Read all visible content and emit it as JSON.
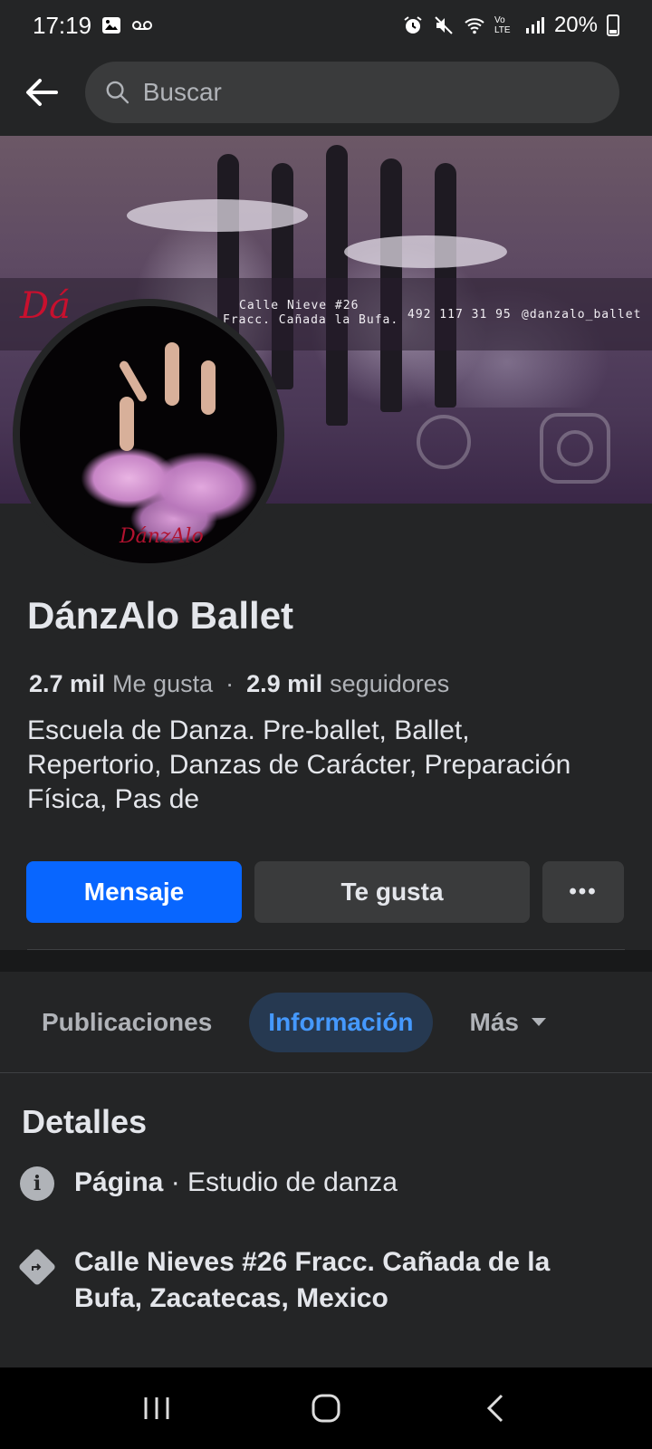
{
  "status_bar": {
    "time": "17:19",
    "network": "Vo LTE",
    "battery": "20%"
  },
  "search": {
    "placeholder": "Buscar"
  },
  "cover": {
    "logo_text": "Dá",
    "address_line1": "Calle Nieve #26",
    "address_line2": "Fracc. Cañada la Bufa.",
    "phone": "492 117 31 95",
    "handle": "@danzalo_ballet"
  },
  "avatar": {
    "signature": "DánzAlo"
  },
  "profile": {
    "name": "DánzAlo Ballet",
    "likes_count": "2.7 mil",
    "likes_label": "Me gusta",
    "separator": "·",
    "followers_count": "2.9 mil",
    "followers_label": "seguidores",
    "bio": "Escuela de Danza. Pre-ballet, Ballet, Repertorio, Danzas de Carácter, Preparación Física, Pas de"
  },
  "actions": {
    "message": "Mensaje",
    "like": "Te gusta",
    "more": "•••"
  },
  "tabs": [
    {
      "label": "Publicaciones",
      "active": false
    },
    {
      "label": "Información",
      "active": true
    },
    {
      "label": "Más",
      "active": false
    }
  ],
  "details": {
    "title": "Detalles",
    "page_label": "Página",
    "page_sep": " · ",
    "page_category": "Estudio de danza",
    "address": "Calle Nieves #26 Fracc. Cañada de la Bufa, Zacatecas, Mexico"
  },
  "colors": {
    "background": "#242526",
    "primary_button": "#0866ff",
    "active_tab_bg": "#263951",
    "active_tab_text": "#4599ff"
  }
}
